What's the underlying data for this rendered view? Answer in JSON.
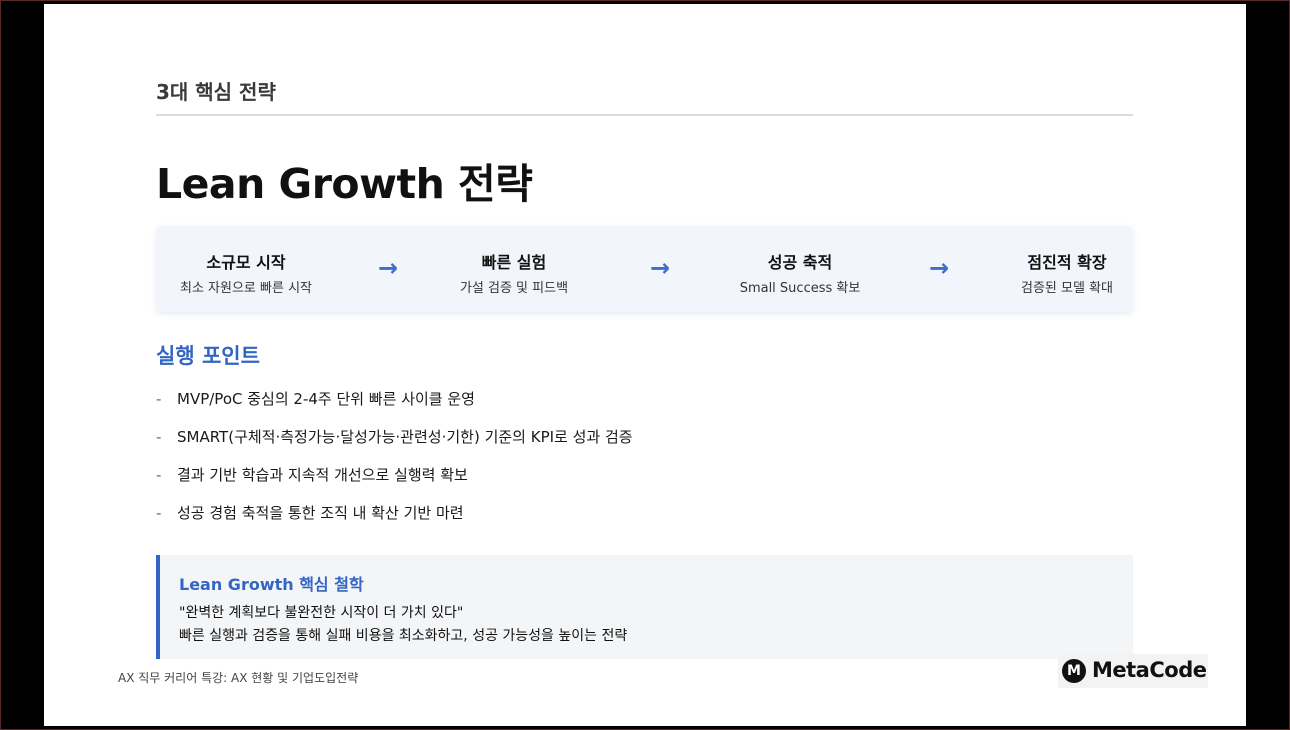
{
  "slide": {
    "section_title": "3대 핵심 전략",
    "title": "Lean Growth 전략",
    "flow": [
      {
        "title": "소규모 시작",
        "subtitle": "최소 자원으로 빠른 시작"
      },
      {
        "title": "빠른 실험",
        "subtitle": "가설 검증 및 피드백"
      },
      {
        "title": "성공 축적",
        "subtitle": "Small Success 확보"
      },
      {
        "title": "점진적 확장",
        "subtitle": "검증된 모델 확대"
      }
    ],
    "arrow_glyph": "→",
    "points_heading": "실행 포인트",
    "bullet_glyph": "-",
    "points": [
      "MVP/PoC 중심의 2-4주 단위 빠른 사이클 운영",
      "SMART(구체적·측정가능·달성가능·관련성·기한) 기준의 KPI로 성과 검증",
      "결과 기반 학습과 지속적 개선으로 실행력 확보",
      "성공 경험 축적을 통한 조직 내 확산 기반 마련"
    ],
    "philosophy": {
      "title": "Lean Growth 핵심 철학",
      "quote": "\"완벽한 계획보다 불완전한 시작이 더 가치 있다\"",
      "description": "빠른 실행과 검증을 통해 실패 비용을 최소화하고, 성공 가능성을 높이는 전략"
    },
    "footer": "AX 직무 커리어 특강: AX 현황 및 기업도입전략",
    "logo": {
      "mark": "M",
      "text": "MetaCode"
    }
  },
  "colors": {
    "accent": "#3366c4",
    "flow_bg": "#f2f6fc",
    "note_bg": "#f4f5f7",
    "frame_bg": "#000000"
  }
}
